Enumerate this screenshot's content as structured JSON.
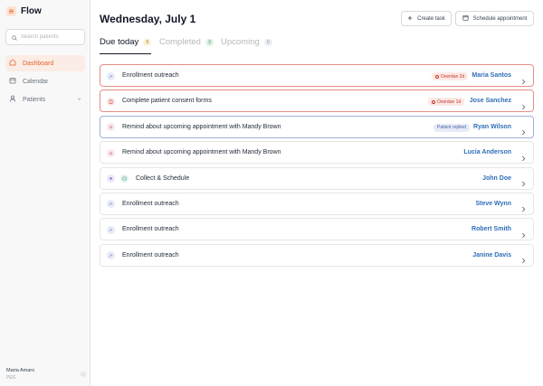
{
  "app": {
    "name": "Flow"
  },
  "sidebar": {
    "search_placeholder": "Search patients",
    "nav": [
      {
        "label": "Dashboard",
        "icon": "home-icon",
        "active": true
      },
      {
        "label": "Calendar",
        "icon": "calendar-icon",
        "active": false
      },
      {
        "label": "Patients",
        "icon": "user-icon",
        "active": false,
        "expandable": true
      }
    ],
    "profile": {
      "name": "Maria Amaro",
      "role": "PES"
    }
  },
  "header": {
    "date_title": "Wednesday, July 1",
    "create_task_label": "Create task",
    "schedule_label": "Schedule appointment"
  },
  "tabs": [
    {
      "label": "Due today",
      "count": "9",
      "active": true
    },
    {
      "label": "Completed",
      "count": "3",
      "active": false
    },
    {
      "label": "Upcoming",
      "count": "0",
      "active": false
    }
  ],
  "tasks": [
    {
      "title": "Enrollment outreach",
      "patient": "Maria Santos",
      "badge": "Overdue 2d",
      "status": "overdue",
      "icon": "phone-icon"
    },
    {
      "title": "Complete patient consent forms",
      "patient": "Jose Sanchez",
      "badge": "Overdue 1d",
      "status": "overdue",
      "icon": "form-icon"
    },
    {
      "title": "Remind about upcoming appointment with Mandy Brown",
      "patient": "Ryan Wilson",
      "badge": "Patient replied",
      "status": "replied",
      "icon": "bell-icon"
    },
    {
      "title": "Remind about upcoming appointment with Mandy Brown",
      "patient": "Lucia Anderson",
      "badge": "",
      "status": "normal",
      "icon": "bell-icon"
    },
    {
      "title": "Collect & Schedule",
      "patient": "John Doe",
      "badge": "",
      "status": "normal",
      "icon": "collect-icon"
    },
    {
      "title": "Enrollment outreach",
      "patient": "Steve Wynn",
      "badge": "",
      "status": "normal",
      "icon": "phone-icon"
    },
    {
      "title": "Enrollment outreach",
      "patient": "Robert Smith",
      "badge": "",
      "status": "normal",
      "icon": "phone-icon"
    },
    {
      "title": "Enrollment outreach",
      "patient": "Janine Davis",
      "badge": "",
      "status": "normal",
      "icon": "phone-icon"
    }
  ],
  "colors": {
    "accent": "#e8652c",
    "link": "#2f6fb8",
    "overdue": "#e58e86",
    "replied": "#9fb0dc"
  }
}
